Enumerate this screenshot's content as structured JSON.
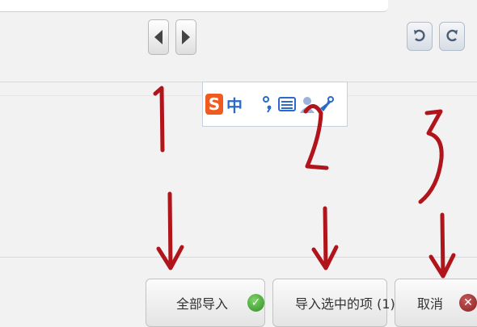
{
  "toolbar": {
    "prev_icon": "triangle-left-icon",
    "next_icon": "triangle-right-icon",
    "undo_icon": "undo-icon",
    "redo_icon": "redo-icon"
  },
  "ime": {
    "logo": "S",
    "mode": "中",
    "symbols": [
      "moon-icon",
      "punctuation-icon",
      "keyboard-icon",
      "settings-icon"
    ]
  },
  "buttons": {
    "import_all": "全部导入",
    "import_selected": "导入选中的项 (1)",
    "cancel": "取消"
  },
  "annotations": {
    "label1": "1",
    "label2": "2",
    "label3": "3",
    "color": "#b0151b"
  }
}
